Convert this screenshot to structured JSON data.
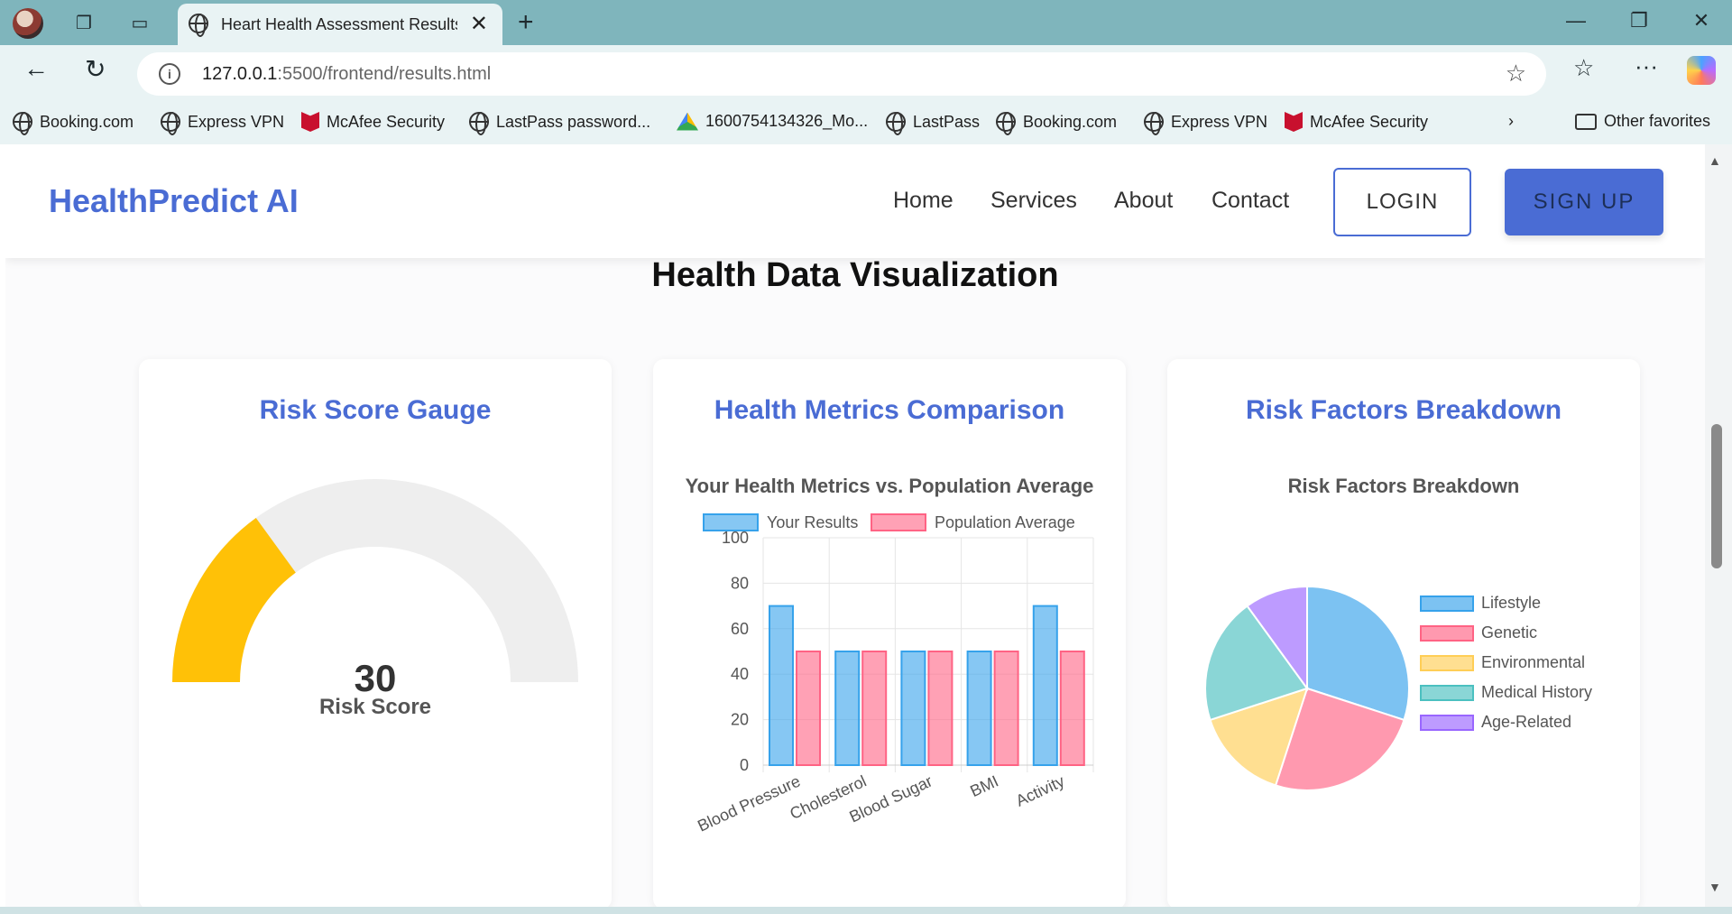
{
  "browser": {
    "tab_title": "Heart Health Assessment Results",
    "url_host": "127.0.0.1",
    "url_rest": ":5500/frontend/results.html",
    "bookmarks": [
      {
        "label": "Booking.com",
        "icon": "globe-icon"
      },
      {
        "label": "Express VPN",
        "icon": "globe-icon"
      },
      {
        "label": "McAfee Security",
        "icon": "mcafee-icon"
      },
      {
        "label": "LastPass password...",
        "icon": "globe-icon"
      },
      {
        "label": "1600754134326_Mo...",
        "icon": "drive-icon"
      },
      {
        "label": "LastPass",
        "icon": "globe-icon"
      },
      {
        "label": "Booking.com",
        "icon": "globe-icon"
      },
      {
        "label": "Express VPN",
        "icon": "globe-icon"
      },
      {
        "label": "McAfee Security",
        "icon": "mcafee-icon"
      }
    ],
    "other_favorites": "Other favorites"
  },
  "site": {
    "logo": "HealthPredict AI",
    "nav": [
      "Home",
      "Services",
      "About",
      "Contact"
    ],
    "login": "LOGIN",
    "signup": "SIGN UP",
    "accent_color": "#4a6cd4"
  },
  "section_title": "Health Data Visualization",
  "cards": {
    "gauge": {
      "title": "Risk Score Gauge",
      "value": "30",
      "label": "Risk Score",
      "max": 100,
      "fill_color": "#ffc107",
      "track_color": "#eeeeee"
    },
    "metrics": {
      "title": "Health Metrics Comparison",
      "chart_title": "Your Health Metrics vs. Population Average"
    },
    "risk": {
      "title": "Risk Factors Breakdown",
      "chart_title": "Risk Factors Breakdown"
    }
  },
  "chart_data": [
    {
      "type": "bar",
      "title": "Your Health Metrics vs. Population Average",
      "categories": [
        "Blood Pressure",
        "Cholesterol",
        "Blood Sugar",
        "BMI",
        "Activity"
      ],
      "series": [
        {
          "name": "Your Results",
          "values": [
            70,
            50,
            50,
            50,
            70
          ],
          "color": "#36a2eb"
        },
        {
          "name": "Population Average",
          "values": [
            50,
            50,
            50,
            50,
            50
          ],
          "color": "#ff6384"
        }
      ],
      "ylim": [
        0,
        100
      ],
      "yticks": [
        0,
        20,
        40,
        60,
        80,
        100
      ],
      "legend": "top",
      "grid": true
    },
    {
      "type": "pie",
      "title": "Risk Factors Breakdown",
      "labels": [
        "Lifestyle",
        "Genetic",
        "Environmental",
        "Medical History",
        "Age-Related"
      ],
      "values": [
        30,
        25,
        15,
        20,
        10
      ],
      "colors": [
        "#36a2eb",
        "#ff6384",
        "#ffce56",
        "#4bc0c0",
        "#9966ff"
      ],
      "legend": "right"
    }
  ]
}
